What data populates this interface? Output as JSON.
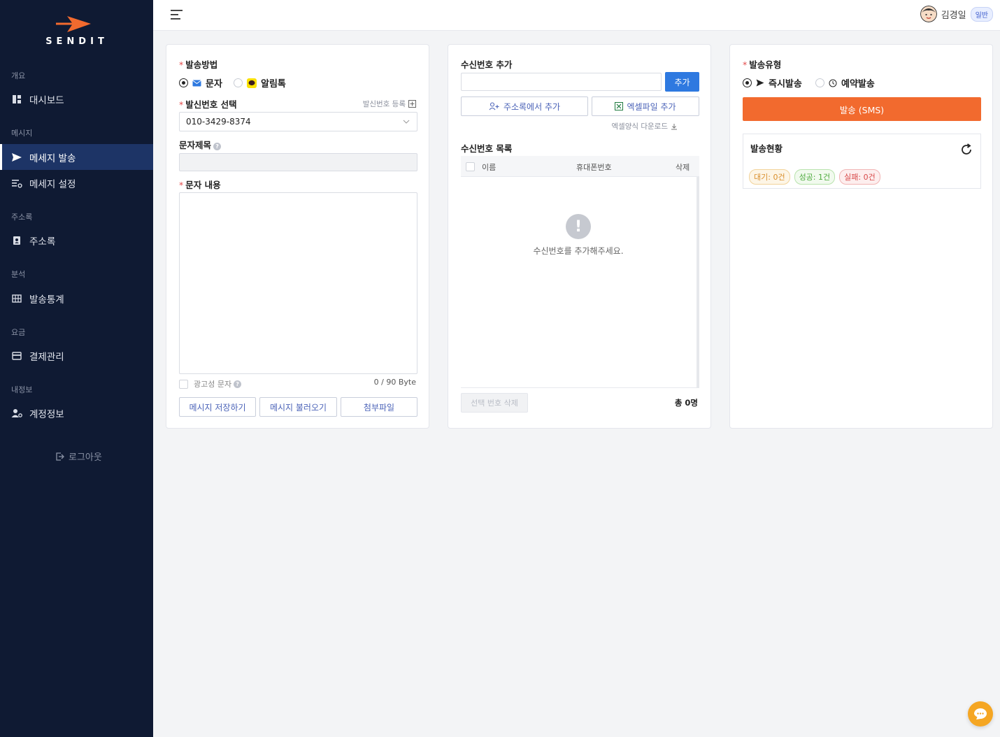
{
  "brand": {
    "name": "SENDIT"
  },
  "sidebar": {
    "sections": [
      {
        "title": "개요",
        "items": [
          {
            "label": "대시보드",
            "icon": "dashboard-icon"
          }
        ]
      },
      {
        "title": "메시지",
        "items": [
          {
            "label": "메세지 발송",
            "icon": "send-icon",
            "active": true
          },
          {
            "label": "메세지 설정",
            "icon": "message-settings-icon"
          }
        ]
      },
      {
        "title": "주소록",
        "items": [
          {
            "label": "주소록",
            "icon": "address-book-icon"
          }
        ]
      },
      {
        "title": "분석",
        "items": [
          {
            "label": "발송통계",
            "icon": "table-icon"
          }
        ]
      },
      {
        "title": "요금",
        "items": [
          {
            "label": "결제관리",
            "icon": "credit-card-icon"
          }
        ]
      },
      {
        "title": "내정보",
        "items": [
          {
            "label": "계정정보",
            "icon": "user-settings-icon"
          }
        ]
      }
    ],
    "logout": "로그아웃"
  },
  "header": {
    "user_name": "김경일",
    "user_badge": "일반"
  },
  "compose": {
    "method_label": "발송방법",
    "method_sms": "문자",
    "method_kakao": "알림톡",
    "sender_label": "발신번호 선택",
    "sender_register": "발신번호 등록",
    "sender_value": "010-3429-8374",
    "subject_label": "문자제목",
    "body_label": "문자 내용",
    "ad_label": "광고성 문자",
    "byte_count": "0 / 90 Byte",
    "btn_save": "메시지 저장하기",
    "btn_load": "메시지 불러오기",
    "btn_attach": "첨부파일"
  },
  "recipients": {
    "add_label": "수신번호 추가",
    "add_button": "추가",
    "from_address_book": "주소록에서 추가",
    "from_excel": "엑셀파일 추가",
    "excel_template": "엑셀양식 다운로드",
    "list_label": "수신번호 목록",
    "col_name": "이름",
    "col_phone": "휴대폰번호",
    "col_delete": "삭제",
    "empty_text": "수신번호를 추가해주세요.",
    "delete_selected": "선택 번호 삭제",
    "total": "총 0명"
  },
  "send": {
    "type_label": "발송유형",
    "type_now": "즉시발송",
    "type_reserve": "예약발송",
    "send_button": "발송 (SMS)",
    "status_label": "발송현황",
    "status_wait": "대기: 0건",
    "status_success": "성공: 1건",
    "status_fail": "실패: 0건"
  },
  "colors": {
    "sidebar_bg": "#0f1a33",
    "active_bg": "#1d3466",
    "brand_orange": "#f26a2e",
    "primary_blue": "#2e79e0"
  }
}
